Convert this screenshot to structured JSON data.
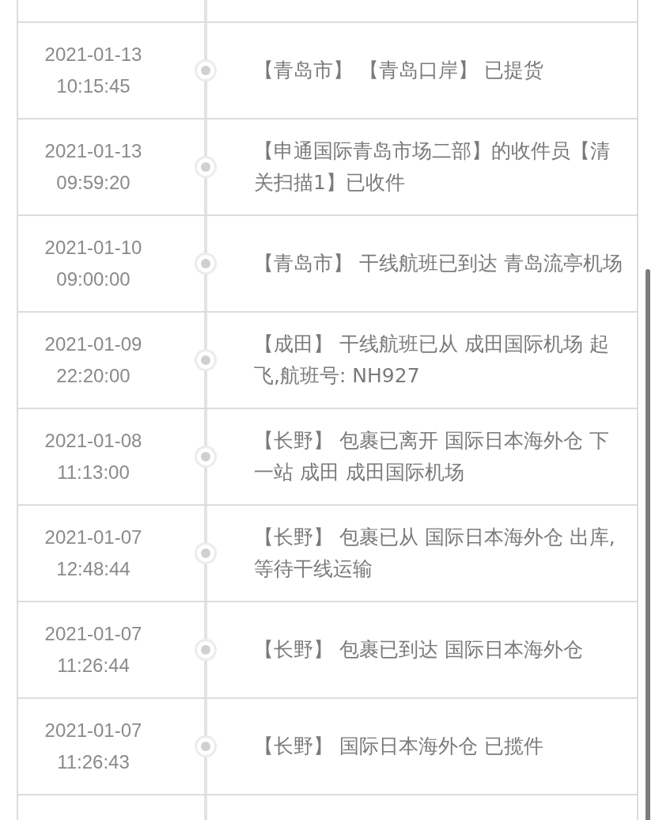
{
  "events": [
    {
      "date": "2021-01-13",
      "time": "10:15:45",
      "text": "【青岛市】 【青岛口岸】 已提货"
    },
    {
      "date": "2021-01-13",
      "time": "09:59:20",
      "text": "【申通国际青岛市场二部】的收件员【清关扫描1】已收件"
    },
    {
      "date": "2021-01-10",
      "time": "09:00:00",
      "text": "【青岛市】 干线航班已到达 青岛流亭机场"
    },
    {
      "date": "2021-01-09",
      "time": "22:20:00",
      "text": "【成田】 干线航班已从 成田国际机场 起飞,航班号: NH927"
    },
    {
      "date": "2021-01-08",
      "time": "11:13:00",
      "text": "【长野】 包裹已离开 国际日本海外仓 下一站 成田 成田国际机场"
    },
    {
      "date": "2021-01-07",
      "time": "12:48:44",
      "text": "【长野】 包裹已从 国际日本海外仓 出库,等待干线运输"
    },
    {
      "date": "2021-01-07",
      "time": "11:26:44",
      "text": "【长野】 包裹已到达 国际日本海外仓"
    },
    {
      "date": "2021-01-07",
      "time": "11:26:43",
      "text": "【长野】 国际日本海外仓 已揽件"
    }
  ]
}
